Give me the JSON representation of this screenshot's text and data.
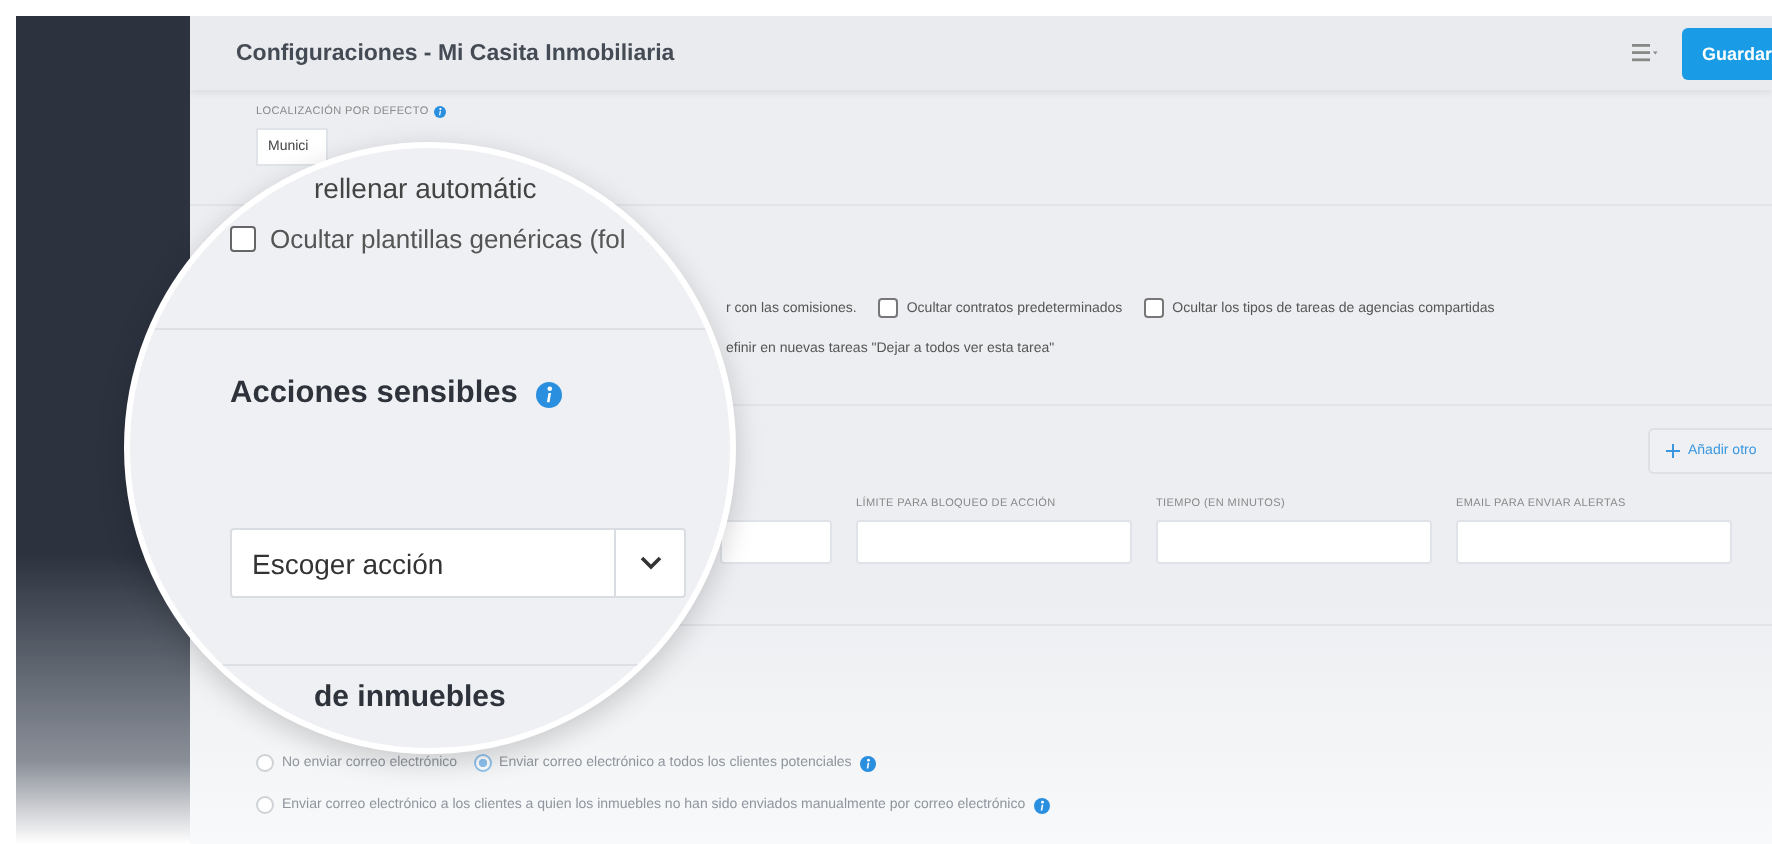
{
  "window": {
    "title": "Configuraciones - Mi Casita Inmobiliaria"
  },
  "header": {
    "save_button": "Guardar"
  },
  "location": {
    "label": "LOCALIZACIÓN POR DEFECTO",
    "select_value": "Munici"
  },
  "options_row": [
    {
      "kind": "text",
      "label": "r con las comisiones."
    },
    {
      "kind": "checkbox",
      "label": "Ocultar contratos predeterminados",
      "checked": false
    },
    {
      "kind": "checkbox",
      "label": "Ocultar los tipos de tareas de agencias compartidas",
      "checked": false
    }
  ],
  "option_line": "efinir en nuevas tareas \"Dejar a todos ver esta tarea\"",
  "add_button": "Añadir otro",
  "fields": [
    {
      "label": "LÍMITE PARA BLOQUEO DE ACCIÓN"
    },
    {
      "label": "TIEMPO (EN MINUTOS)"
    },
    {
      "label": "EMAIL PARA ENVIAR ALERTAS"
    }
  ],
  "email_option_rows": [
    {
      "options": [
        {
          "label": "No enviar correo electrónico",
          "selected": false,
          "info": false
        },
        {
          "label": "Enviar correo electrónico a todos los clientes potenciales",
          "selected": true,
          "info": true
        }
      ]
    },
    {
      "options": [
        {
          "label": "Enviar correo electrónico a los clientes a quien los inmuebles no han sido enviados manualmente por correo electrónico",
          "selected": false,
          "info": true
        }
      ]
    }
  ],
  "magnifier": {
    "autofill_text": "rellenar automátic",
    "template_option": {
      "label": "Ocultar plantillas genéricas (fol",
      "checked": false
    },
    "section_title": "Acciones sensibles",
    "action_select": "Escoger acción",
    "next_section_title": "de inmuebles"
  }
}
